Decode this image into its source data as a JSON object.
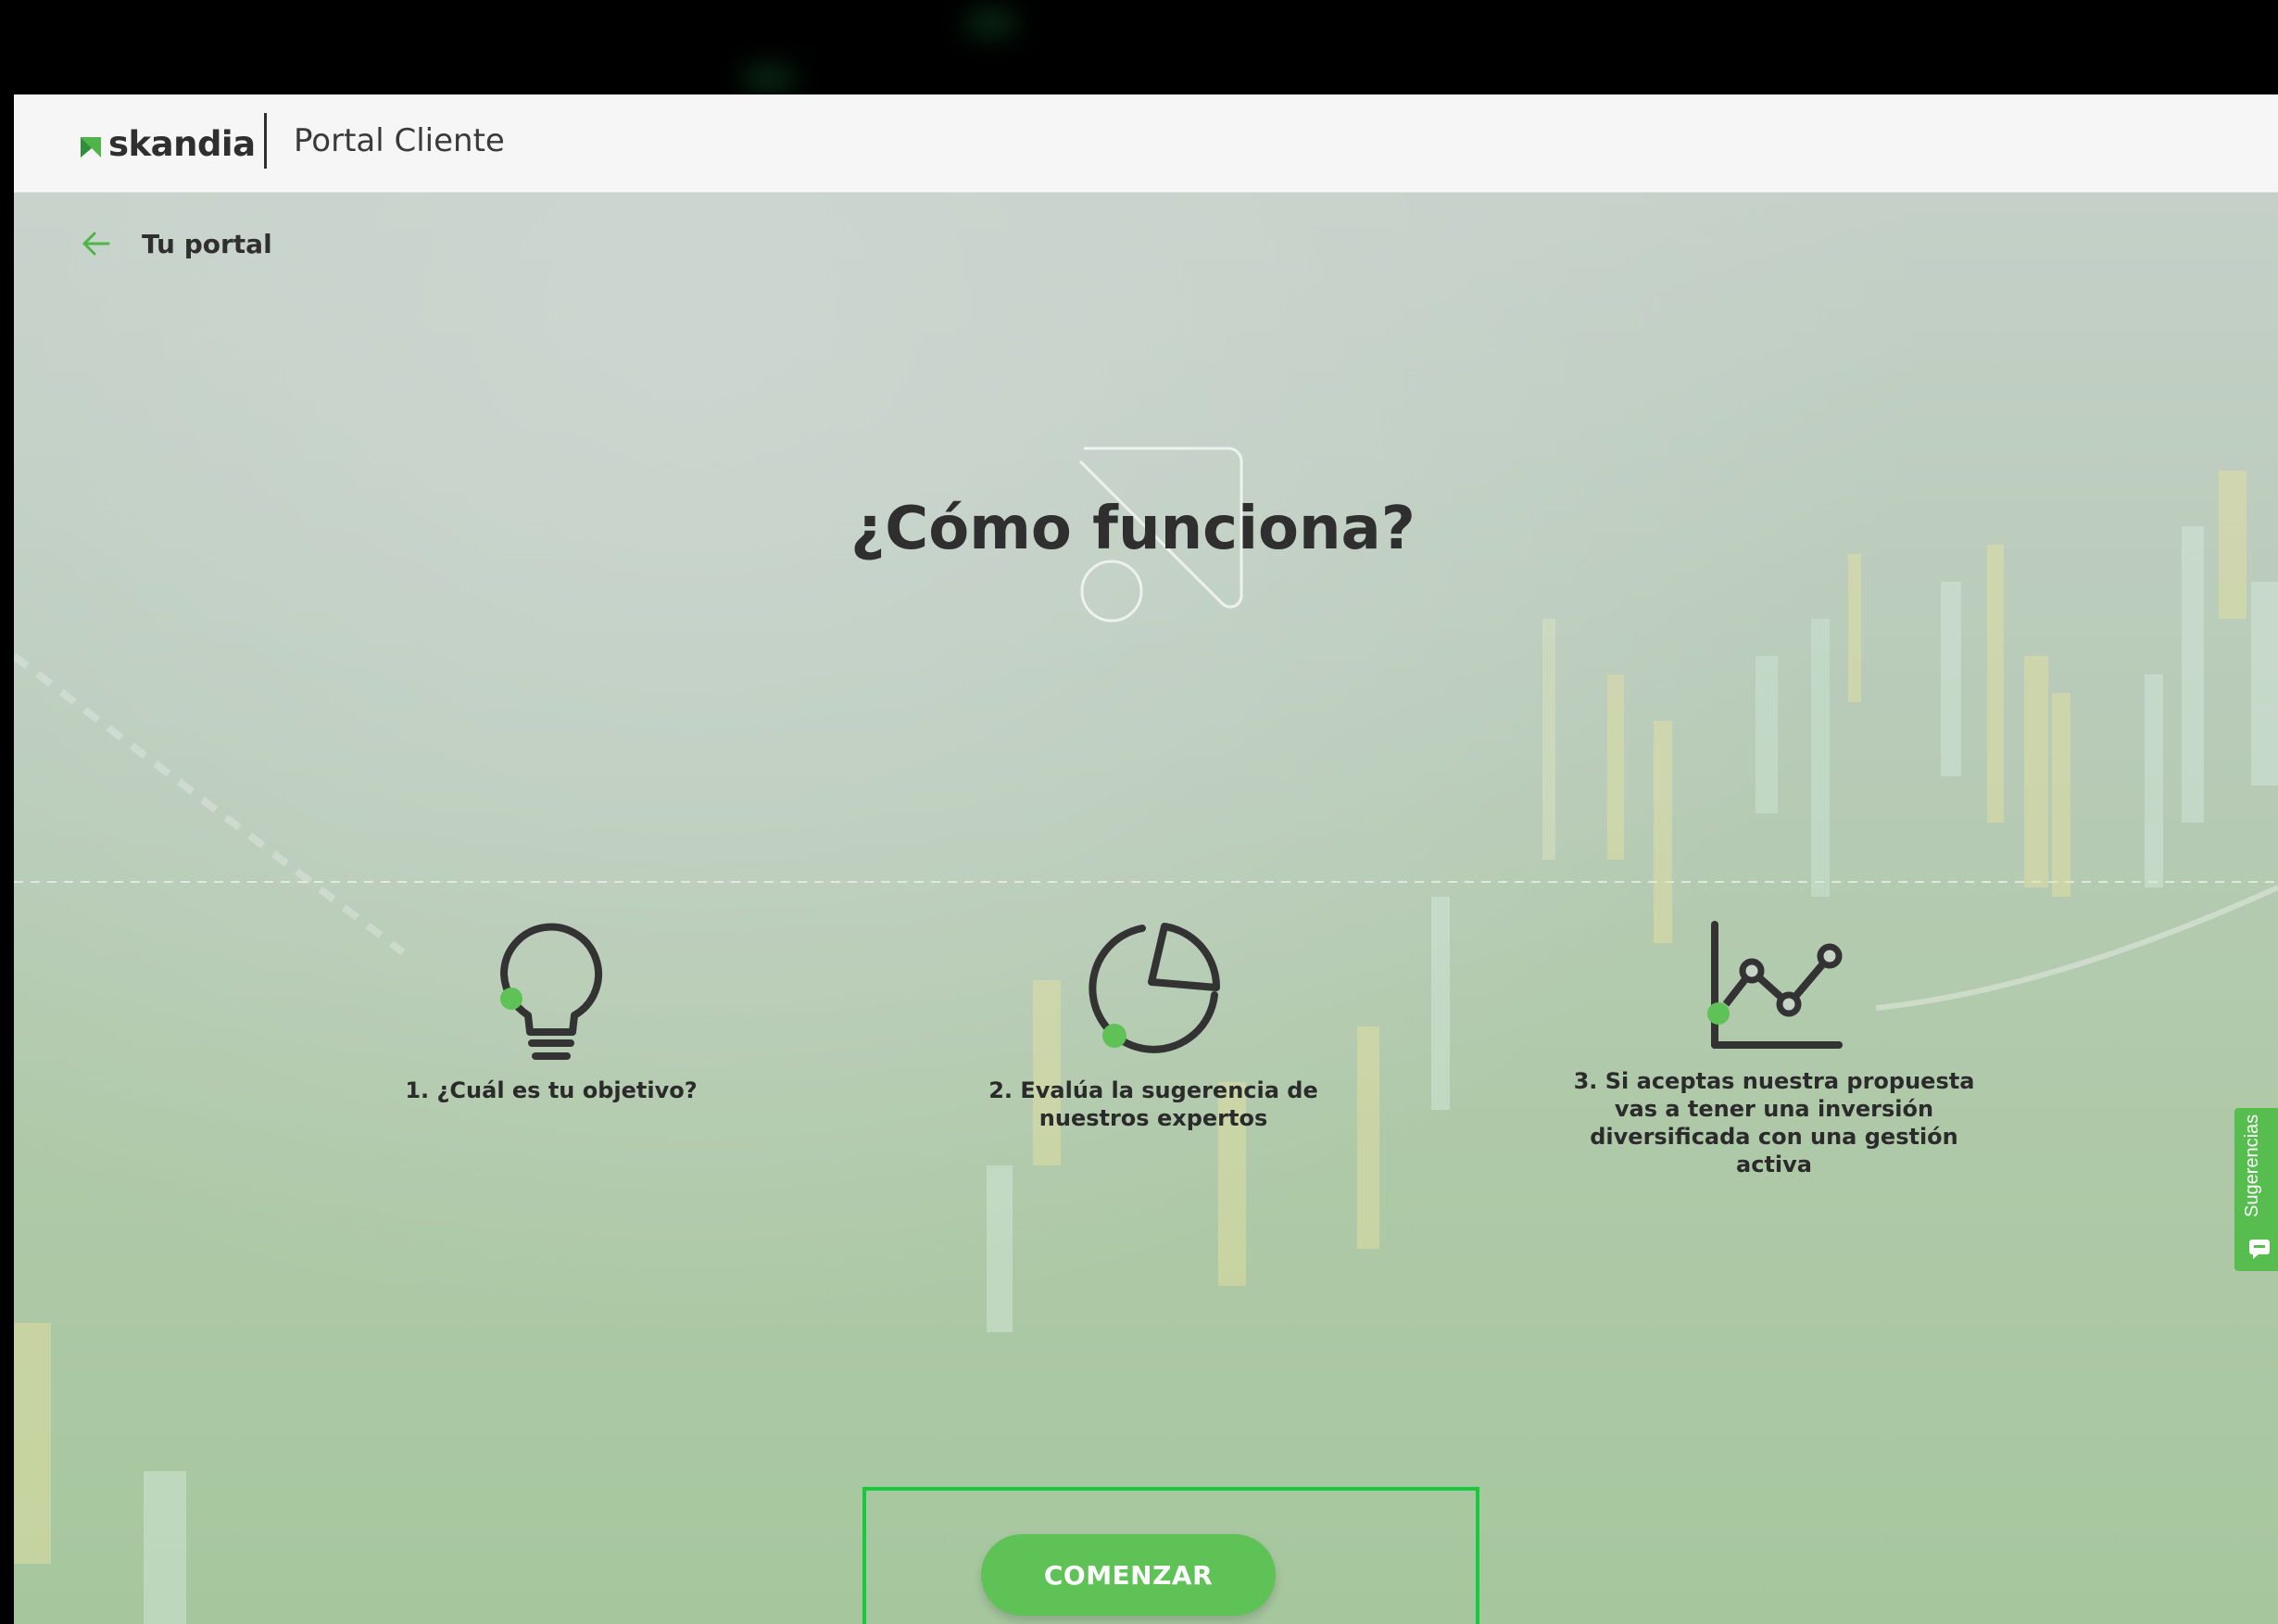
{
  "header": {
    "brand": "skandia",
    "portal_title": "Portal Cliente"
  },
  "nav": {
    "back_label": "Tu portal",
    "back_icon": "arrow-left-icon"
  },
  "main": {
    "title": "¿Cómo funciona?",
    "steps": [
      {
        "icon": "lightbulb-icon",
        "label": "1. ¿Cuál es tu objetivo?"
      },
      {
        "icon": "pie-chart-icon",
        "label": "2. Evalúa la sugerencia de nuestros expertos"
      },
      {
        "icon": "line-chart-icon",
        "label": "3. Si aceptas nuestra propuesta vas a tener una inversión diversificada con una gestión activa"
      }
    ],
    "cta_label": "COMENZAR"
  },
  "feedback": {
    "label": "Sugerencias",
    "icon": "chat-icon"
  },
  "colors": {
    "accent": "#5fc257",
    "highlight": "#17c93d",
    "text": "#2f2f2f"
  }
}
